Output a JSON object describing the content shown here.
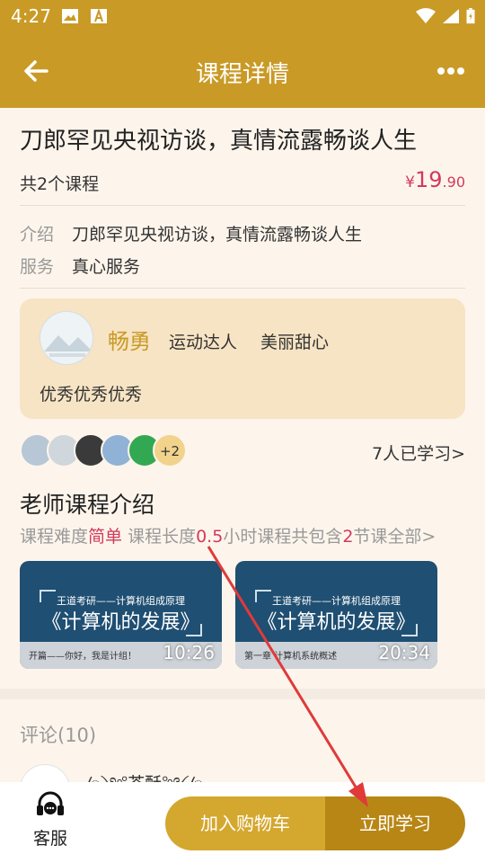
{
  "status_bar": {
    "time": "4:27"
  },
  "header": {
    "title": "课程详情"
  },
  "course": {
    "title": "刀郎罕见央视访谈，真情流露畅谈人生",
    "count_label": "共2个课程",
    "price": {
      "currency": "¥",
      "integer": "19",
      "decimal": ".90"
    },
    "intro_label": "介绍",
    "intro_value": "刀郎罕见央视访谈，真情流露畅谈人生",
    "service_label": "服务",
    "service_value": "真心服务"
  },
  "teacher": {
    "name": "畅勇",
    "tags": [
      "运动达人",
      "美丽甜心"
    ],
    "description": "优秀优秀优秀"
  },
  "learners": {
    "more": "+2",
    "count_label": "7人已学习>"
  },
  "teacher_section": {
    "title": "老师课程介绍",
    "meta": {
      "difficulty_label": "课程难度",
      "difficulty_value": "简单",
      "length_label": "课程长度",
      "length_value": "0.5",
      "length_unit": "小时课程共包含",
      "lessons_value": "2",
      "lessons_suffix": "节课全部>"
    }
  },
  "videos": [
    {
      "header": "王道考研——计算机组成原理",
      "title": "《计算机的发展》",
      "subtitle": "开篇——你好，我是计组！",
      "duration": "10:26"
    },
    {
      "header": "王道考研——计算机组成原理",
      "title": "《计算机的发展》",
      "subtitle": "第一章 计算机系统概述",
      "duration": "20:34"
    }
  ],
  "comments": {
    "title": "评论(10)",
    "first_user": "ꦿ༺茶酥༻ꦿ"
  },
  "bottom_bar": {
    "service_label": "客服",
    "cart_label": "加入购物车",
    "learn_label": "立即学习"
  },
  "colors": {
    "brand": "#c99a26",
    "accent": "#d23a5c",
    "card_bg": "#f7e4c4",
    "annotation": "#e03a3a"
  }
}
